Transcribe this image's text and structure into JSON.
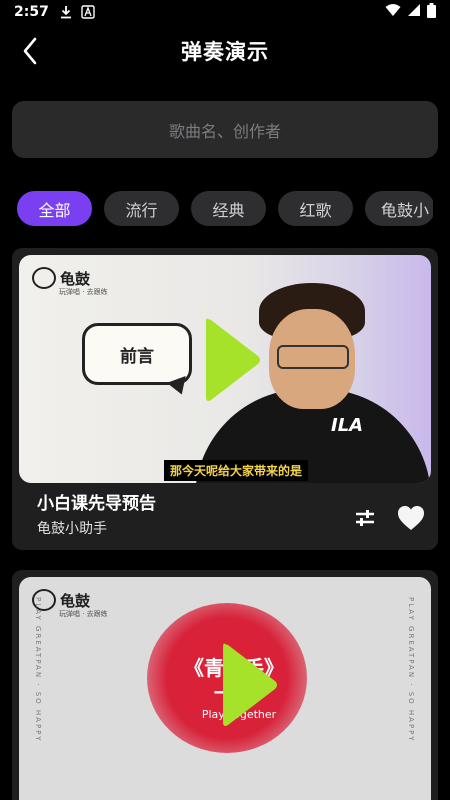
{
  "status": {
    "time": "2:57"
  },
  "header": {
    "title": "弹奏演示"
  },
  "search": {
    "placeholder": "歌曲名、创作者"
  },
  "chips": [
    "全部",
    "流行",
    "经典",
    "红歌",
    "龟鼓小"
  ],
  "cards": [
    {
      "title": "小白课先导预告",
      "author": "龟鼓小助手",
      "thumb": {
        "logo": "龟鼓",
        "logo_sub": "玩弹唱 · 去跟练",
        "bubble": "前言",
        "subtitle": "那今天呢给大家带来的是",
        "shirt_text": "ILA"
      }
    },
    {
      "thumb": {
        "logo": "龟鼓",
        "logo_sub": "玩弹唱 · 去跟练",
        "side_left": "PLAY GREATPAN · SO HAPPY",
        "side_right": "PLAY GREATPAN · SO HAPPY",
        "line1": "《青鼓手》",
        "line2": "一弹",
        "line3": "Play Together"
      }
    }
  ],
  "colors": {
    "accent": "#7a3ff0",
    "play": "#a6e22a"
  },
  "icons": [
    "back-arrow-icon",
    "download-icon",
    "font-icon",
    "wifi-icon",
    "signal-icon",
    "battery-icon",
    "play-icon",
    "adjust-icon",
    "heart-icon"
  ]
}
